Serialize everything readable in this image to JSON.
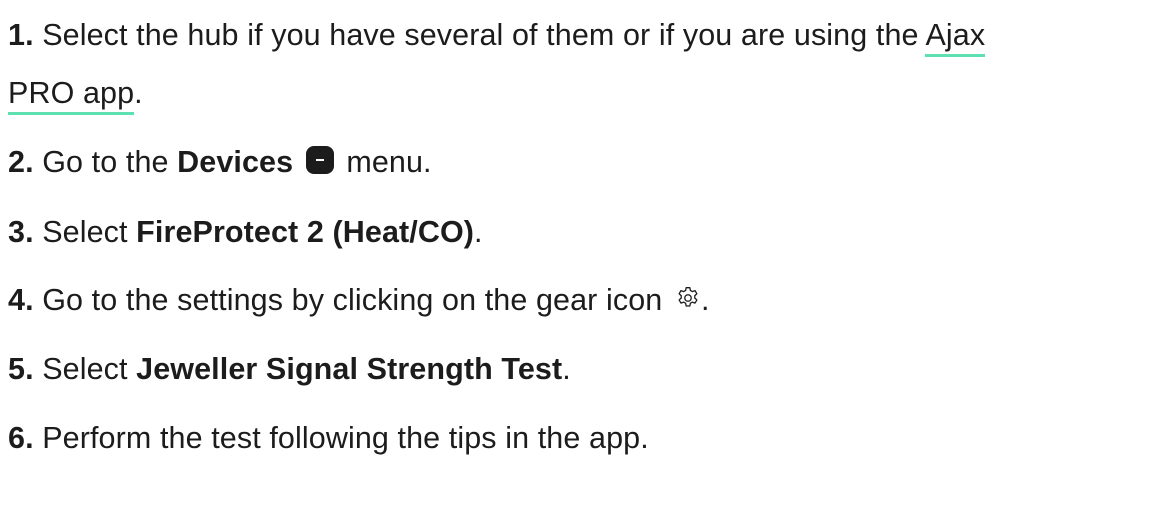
{
  "steps": [
    {
      "number": "1.",
      "text_before": "Select the hub if you have several of them or if you are using the",
      "link_text_1": "Ajax",
      "link_text_2": "PRO app",
      "text_after": "."
    },
    {
      "number": "2.",
      "text_before": "Go to the",
      "bold": "Devices",
      "icon": "devices-icon",
      "text_after": "menu."
    },
    {
      "number": "3.",
      "text_before": "Select",
      "bold": "FireProtect 2 (Heat/CO)",
      "text_after": "."
    },
    {
      "number": "4.",
      "text_before": "Go to the settings by clicking on the gear icon",
      "icon": "gear-icon",
      "text_after": "."
    },
    {
      "number": "5.",
      "text_before": "Select",
      "bold": "Jeweller Signal Strength Test",
      "text_after": "."
    },
    {
      "number": "6.",
      "text_before": "Perform the test following the tips in the app."
    }
  ],
  "colors": {
    "text": "#1c1c1c",
    "link_underline": "#5ee0b0"
  }
}
